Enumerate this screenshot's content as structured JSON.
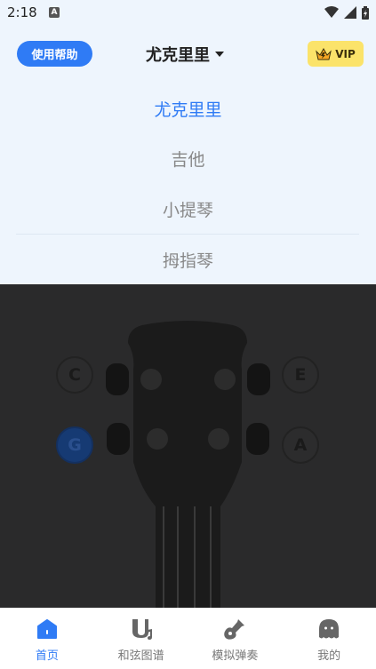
{
  "status_bar": {
    "time": "2:18",
    "notification_badge": "A"
  },
  "header": {
    "help_label": "使用帮助",
    "title": "尤克里里",
    "vip_label": "VIP"
  },
  "dropdown": {
    "items": [
      {
        "label": "尤克里里",
        "active": true
      },
      {
        "label": "吉他",
        "active": false
      },
      {
        "label": "小提琴",
        "active": false
      },
      {
        "label": "拇指琴",
        "active": false
      }
    ]
  },
  "tuner": {
    "pegs": [
      {
        "note": "C",
        "selected": false
      },
      {
        "note": "E",
        "selected": false
      },
      {
        "note": "G",
        "selected": true
      },
      {
        "note": "A",
        "selected": false
      }
    ]
  },
  "tabbar": {
    "tabs": [
      {
        "label": "首页",
        "icon": "home-icon",
        "active": true
      },
      {
        "label": "和弦图谱",
        "icon": "chord-chart-icon",
        "active": false
      },
      {
        "label": "模拟弹奏",
        "icon": "guitar-icon",
        "active": false
      },
      {
        "label": "我的",
        "icon": "profile-ghost-icon",
        "active": false
      }
    ]
  },
  "colors": {
    "accent": "#2f7bf5",
    "vip_bg": "#fbe36a",
    "panel_bg": "#eef5fd",
    "stage_bg": "#2a2a2b"
  }
}
